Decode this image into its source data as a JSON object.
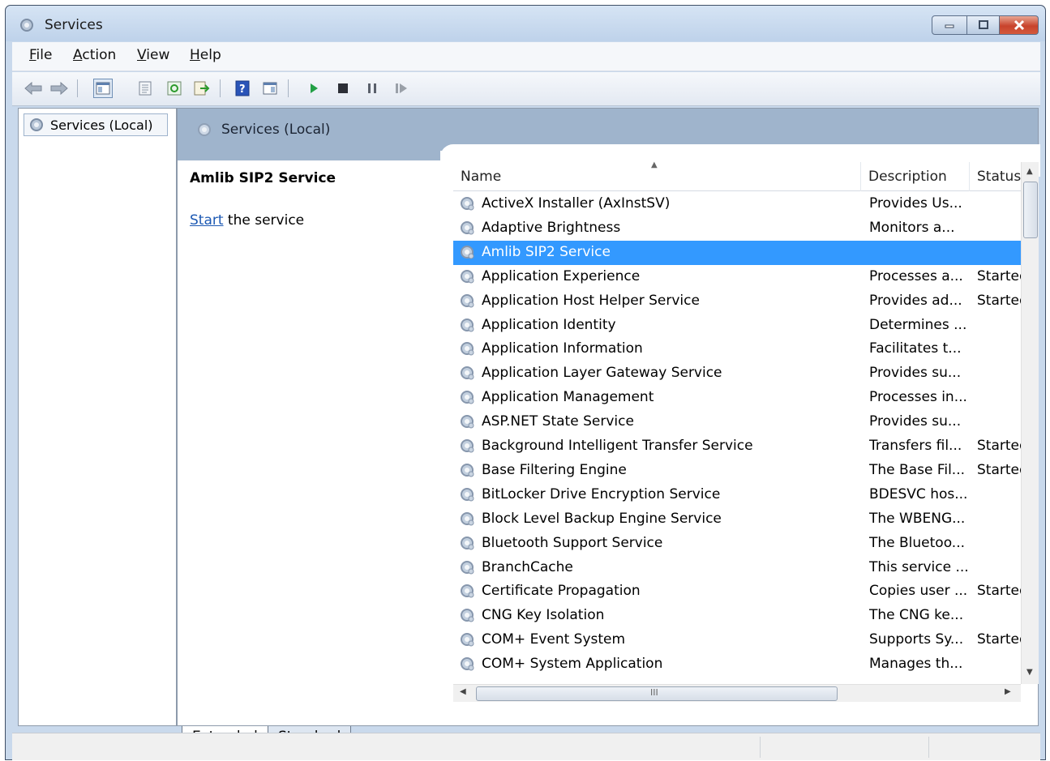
{
  "window": {
    "title": "Services"
  },
  "menu": {
    "items": [
      {
        "accel": "F",
        "rest": "ile"
      },
      {
        "accel": "A",
        "rest": "ction"
      },
      {
        "accel": "V",
        "rest": "iew"
      },
      {
        "accel": "H",
        "rest": "elp"
      }
    ]
  },
  "tree": {
    "root_label": "Services (Local)"
  },
  "pane": {
    "header_title": "Services (Local)",
    "selected_service": "Amlib SIP2 Service",
    "action_link": "Start",
    "action_rest": " the service"
  },
  "columns": {
    "name": "Name",
    "description": "Description",
    "status": "Status"
  },
  "services": [
    {
      "name": "ActiveX Installer (AxInstSV)",
      "description": "Provides Us...",
      "status": ""
    },
    {
      "name": "Adaptive Brightness",
      "description": "Monitors a...",
      "status": ""
    },
    {
      "name": "Amlib SIP2 Service",
      "description": "",
      "status": ""
    },
    {
      "name": "Application Experience",
      "description": "Processes a...",
      "status": "Started"
    },
    {
      "name": "Application Host Helper Service",
      "description": "Provides ad...",
      "status": "Started"
    },
    {
      "name": "Application Identity",
      "description": "Determines ...",
      "status": ""
    },
    {
      "name": "Application Information",
      "description": "Facilitates t...",
      "status": ""
    },
    {
      "name": "Application Layer Gateway Service",
      "description": "Provides su...",
      "status": ""
    },
    {
      "name": "Application Management",
      "description": "Processes in...",
      "status": ""
    },
    {
      "name": "ASP.NET State Service",
      "description": "Provides su...",
      "status": ""
    },
    {
      "name": "Background Intelligent Transfer Service",
      "description": "Transfers fil...",
      "status": "Started"
    },
    {
      "name": "Base Filtering Engine",
      "description": "The Base Fil...",
      "status": "Started"
    },
    {
      "name": "BitLocker Drive Encryption Service",
      "description": "BDESVC hos...",
      "status": ""
    },
    {
      "name": "Block Level Backup Engine Service",
      "description": "The WBENG...",
      "status": ""
    },
    {
      "name": "Bluetooth Support Service",
      "description": "The Bluetoo...",
      "status": ""
    },
    {
      "name": "BranchCache",
      "description": "This service ...",
      "status": ""
    },
    {
      "name": "Certificate Propagation",
      "description": "Copies user ...",
      "status": "Started"
    },
    {
      "name": "CNG Key Isolation",
      "description": "The CNG ke...",
      "status": ""
    },
    {
      "name": "COM+ Event System",
      "description": "Supports Sy...",
      "status": "Started"
    },
    {
      "name": "COM+ System Application",
      "description": "Manages th...",
      "status": ""
    }
  ],
  "selected_index": 2,
  "tabs": {
    "extended": "Extended",
    "standard": "Standard"
  },
  "hscroll_grip": "III",
  "colors": {
    "selection": "#3399ff",
    "header_band": "#9fb4cc",
    "link": "#1d59b3"
  }
}
